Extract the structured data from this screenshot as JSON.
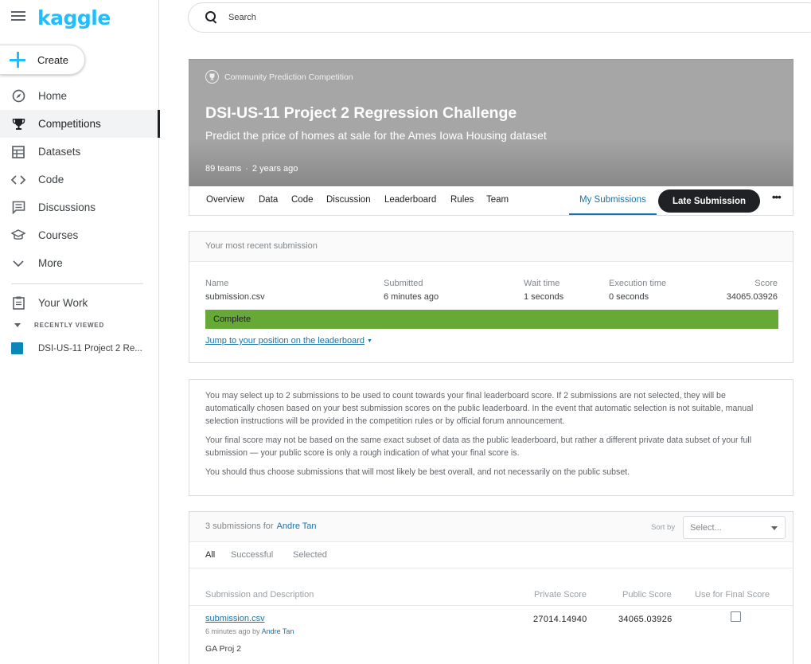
{
  "app": {
    "logo": "kaggle"
  },
  "sidebar": {
    "create_label": "Create",
    "items": [
      {
        "label": "Home",
        "icon": "compass-icon"
      },
      {
        "label": "Competitions",
        "icon": "trophy-icon"
      },
      {
        "label": "Datasets",
        "icon": "table-icon"
      },
      {
        "label": "Code",
        "icon": "code-icon"
      },
      {
        "label": "Discussions",
        "icon": "comments-icon"
      },
      {
        "label": "Courses",
        "icon": "graduation-cap-icon"
      },
      {
        "label": "More",
        "icon": "chevron-down-icon"
      }
    ],
    "active_item": "Competitions",
    "your_work": "Your Work",
    "recently_viewed_label": "RECENTLY VIEWED",
    "recent_item": "DSI-US-11 Project 2 Re...",
    "recent_item_color": "#0c85b8"
  },
  "search": {
    "placeholder": "Search"
  },
  "competition": {
    "type": "Community Prediction Competition",
    "title": "DSI-US-11 Project 2 Regression Challenge",
    "subtitle": "Predict the price of homes at sale for the Ames Iowa Housing dataset",
    "teams": "89 teams",
    "age": "2 years ago"
  },
  "tabs": {
    "items": [
      "Overview",
      "Data",
      "Code",
      "Discussion",
      "Leaderboard",
      "Rules",
      "Team"
    ],
    "active": "My Submissions",
    "late_submission": "Late Submission",
    "more": "•••"
  },
  "recent_submission": {
    "heading": "Your most recent submission",
    "columns": {
      "name": {
        "header": "Name",
        "value": "submission.csv"
      },
      "submitted": {
        "header": "Submitted",
        "value": "6 minutes ago"
      },
      "wait": {
        "header": "Wait time",
        "value": "1 seconds"
      },
      "execution": {
        "header": "Execution time",
        "value": "0 seconds"
      },
      "score": {
        "header": "Score",
        "value": "34065.03926"
      }
    },
    "status": "Complete",
    "status_color": "#66a937",
    "jump_link": "Jump to your position on the leaderboard"
  },
  "info": {
    "p1": "You may select up to 2 submissions to be used to count towards your final leaderboard score. If 2 submissions are not selected, they will be automatically chosen based on your best submission scores on the public leaderboard. In the event that automatic selection is not suitable, manual selection instructions will be provided in the competition rules or by official forum announcement.",
    "p2": "Your final score may not be based on the same exact subset of data as the public leaderboard, but rather a different private data subset of your full submission — your public score is only a rough indication of what your final score is.",
    "p3": "You should thus choose submissions that will most likely be best overall, and not necessarily on the public subset."
  },
  "submissions": {
    "count_text": "3 submissions for",
    "user": "Andre Tan",
    "sort_label": "Sort by",
    "sort_placeholder": "Select...",
    "filters": [
      "All",
      "Successful",
      "Selected"
    ],
    "active_filter": "All",
    "headers": {
      "description": "Submission and Description",
      "private": "Private Score",
      "public": "Public Score",
      "final": "Use for Final Score"
    },
    "rows": [
      {
        "file": "submission.csv",
        "time": "6 minutes ago by",
        "user": "Andre Tan",
        "description": "GA Proj 2",
        "private_score": "27014.14940",
        "public_score": "34065.03926",
        "selected": false
      }
    ]
  }
}
